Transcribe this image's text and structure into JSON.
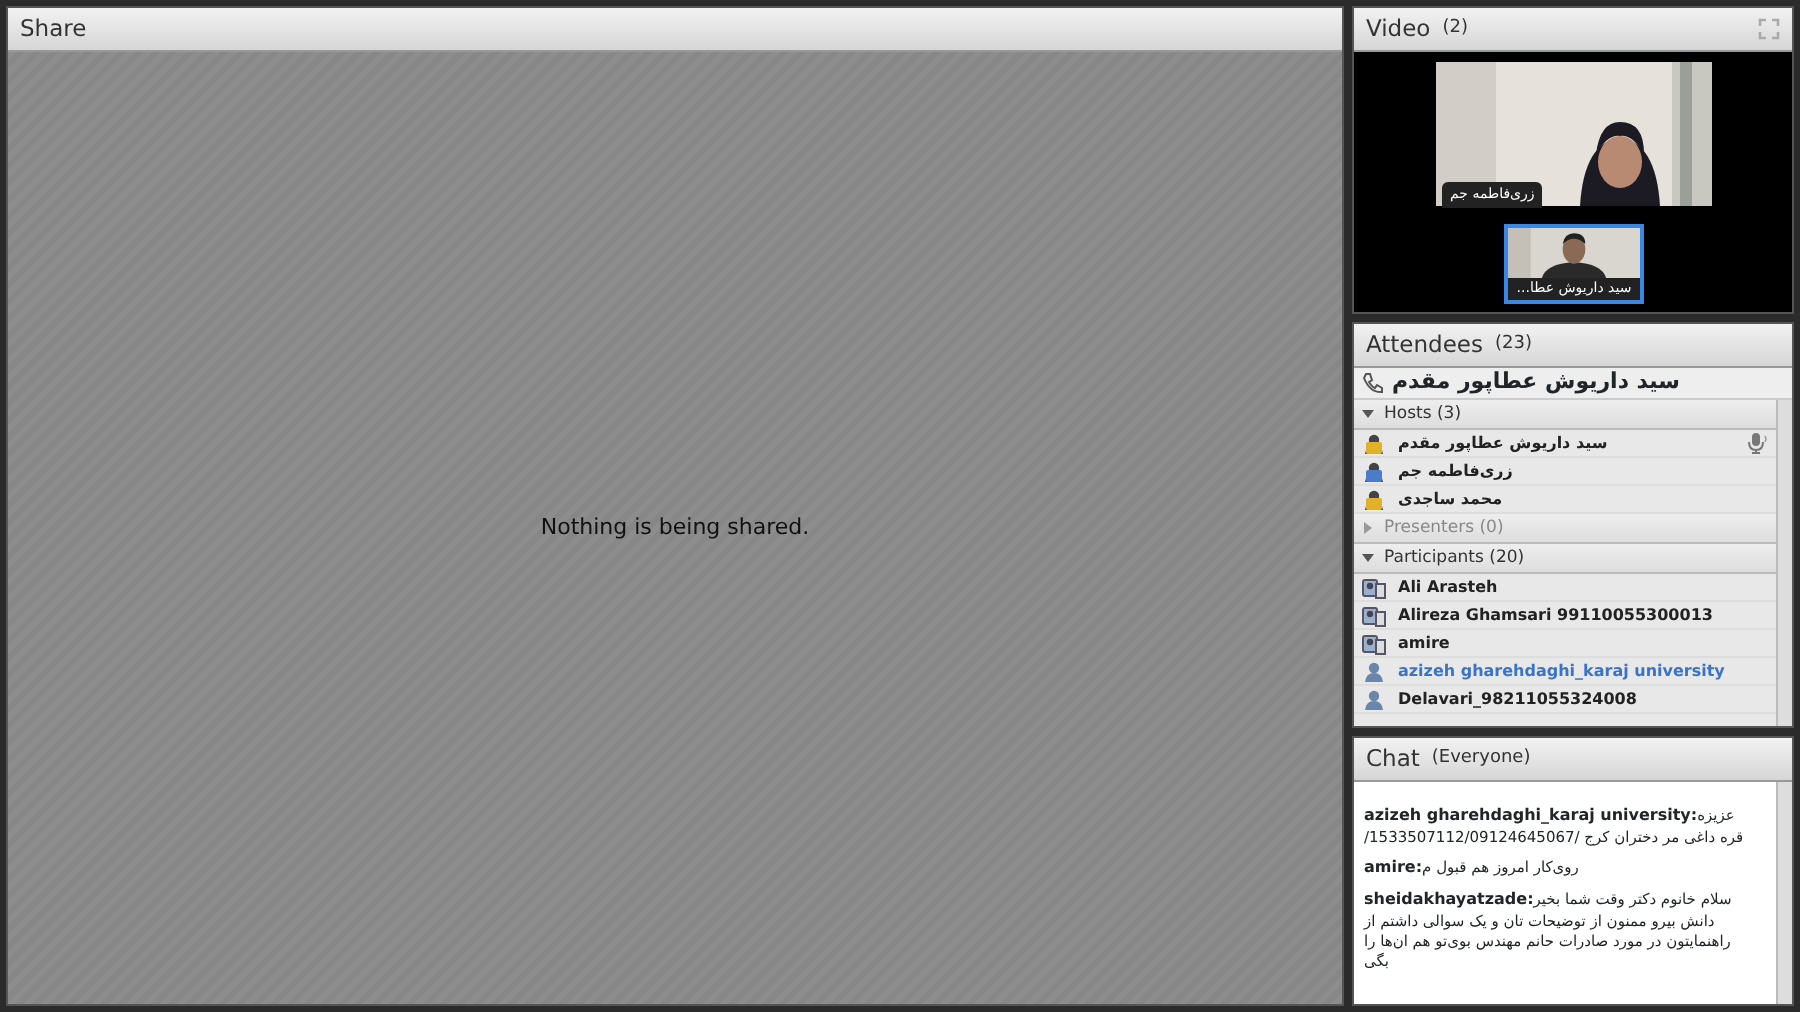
{
  "share": {
    "title": "Share",
    "message": "Nothing is being shared."
  },
  "video": {
    "title": "Video",
    "count": "(2)",
    "main_label": "زری‌فاطمه جم",
    "thumb_label": "...سید داریوش عطا",
    "thumb_selected": true
  },
  "attendees": {
    "title": "Attendees",
    "count": "(23)",
    "speaker": "سید داریوش عطاپور مقدم",
    "groups": [
      {
        "label": "Hosts (3)",
        "expanded": true,
        "items": [
          {
            "name": "سید داریوش عطاپور مقدم",
            "kind": "host",
            "self": false,
            "mic": true
          },
          {
            "name": "زری‌فاطمه جم",
            "kind": "host-camera",
            "self": false,
            "mic": false
          },
          {
            "name": "محمد ساجدی",
            "kind": "host",
            "self": false,
            "mic": false
          }
        ]
      },
      {
        "label": "Presenters (0)",
        "expanded": false
      },
      {
        "label": "Participants (20)",
        "expanded": true,
        "items": [
          {
            "name": "Ali Arasteh",
            "kind": "phone",
            "self": false,
            "mic": false
          },
          {
            "name": "Alireza Ghamsari 99110055300013",
            "kind": "phone",
            "self": false,
            "mic": false
          },
          {
            "name": "amire",
            "kind": "phone",
            "self": false,
            "mic": false
          },
          {
            "name": "azizeh gharehdaghi_karaj university",
            "kind": "user",
            "self": true,
            "mic": false
          },
          {
            "name": "Delavari_98211055324008",
            "kind": "user",
            "self": false,
            "mic": false
          }
        ]
      }
    ]
  },
  "chat": {
    "title": "Chat",
    "scope": "(Everyone)",
    "messages": [
      {
        "sender": "azizeh gharehdaghi_karaj university:",
        "text": "عزیزه قره داغی‌ مر دختران کرج /1533507112/09124645067/"
      },
      {
        "sender": "amire:",
        "text": "روی‌کار امروز هم قبول م"
      },
      {
        "sender": "sheidakhayatzade:",
        "text": "سلام خانوم دکتر وقت شما بخیر دانش بیرو ممنون از توضیحات تان و یک سوالی داشتم از راهنمایتون در مورد صادرات حانم مهندس بوی‌تو هم ان‌ها را بگی"
      }
    ]
  }
}
